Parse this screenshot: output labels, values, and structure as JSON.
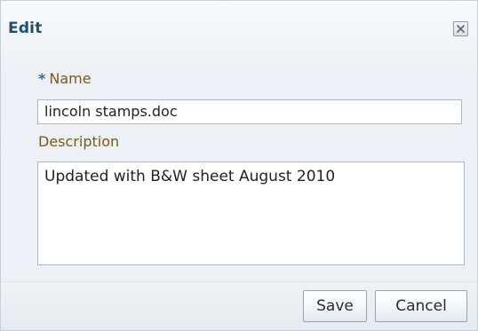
{
  "dialog": {
    "title": "Edit",
    "close_icon": "close-icon",
    "required_marker": "*",
    "fields": {
      "name_label": "Name",
      "name_value": "lincoln stamps.doc",
      "description_label": "Description",
      "description_value": "Updated with B&W sheet August 2010"
    },
    "buttons": {
      "save_label": "Save",
      "cancel_label": "Cancel"
    },
    "colors": {
      "title": "#1f4f73",
      "label": "#7a5b12",
      "required_star": "#2f6fa3",
      "input_border": "#a9b8c4",
      "dialog_background": "#eef2f6"
    }
  }
}
